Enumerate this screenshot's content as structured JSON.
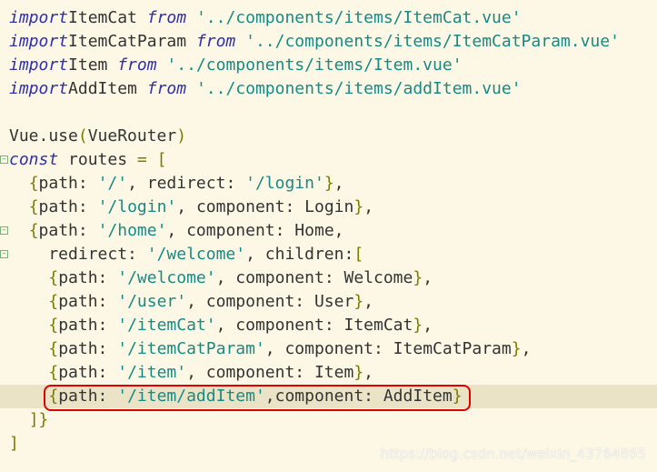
{
  "colors": {
    "background": "#fdf8e6",
    "keyword": "#2f2fb0",
    "string": "#178a84",
    "bracket": "#7b7b00",
    "highlight_line": "#ebe3c6",
    "annotation_box": "#e00000"
  },
  "lines": [
    [
      [
        "kw",
        "import"
      ],
      [
        "",
        "ItemCat "
      ],
      [
        "kw",
        "from"
      ],
      [
        "",
        " "
      ],
      [
        "str",
        "'../components/items/ItemCat.vue'"
      ]
    ],
    [
      [
        "kw",
        "import"
      ],
      [
        "",
        "ItemCatParam "
      ],
      [
        "kw",
        "from"
      ],
      [
        "",
        " "
      ],
      [
        "str",
        "'../components/items/ItemCatParam.vue'"
      ]
    ],
    [
      [
        "kw",
        "import"
      ],
      [
        "",
        "Item "
      ],
      [
        "kw",
        "from"
      ],
      [
        "",
        " "
      ],
      [
        "str",
        "'../components/items/Item.vue'"
      ]
    ],
    [
      [
        "kw",
        "import"
      ],
      [
        "",
        "AddItem "
      ],
      [
        "kw",
        "from"
      ],
      [
        "",
        " "
      ],
      [
        "str",
        "'../components/items/addItem.vue'"
      ]
    ],
    [],
    [
      [
        "",
        "Vue.use"
      ],
      [
        "br",
        "("
      ],
      [
        "",
        "VueRouter"
      ],
      [
        "br",
        ")"
      ]
    ],
    [
      [
        "kw",
        "const"
      ],
      [
        "",
        " routes "
      ],
      [
        "op",
        "="
      ],
      [
        "",
        " "
      ],
      [
        "br",
        "["
      ]
    ],
    [
      [
        "",
        "  "
      ],
      [
        "br",
        "{"
      ],
      [
        "",
        "path: "
      ],
      [
        "str",
        "'/'"
      ],
      [
        "",
        ", redirect: "
      ],
      [
        "str",
        "'/login'"
      ],
      [
        "br",
        "}"
      ],
      [
        "",
        ","
      ]
    ],
    [
      [
        "",
        "  "
      ],
      [
        "br",
        "{"
      ],
      [
        "",
        "path: "
      ],
      [
        "str",
        "'/login'"
      ],
      [
        "",
        ", component: Login"
      ],
      [
        "br",
        "}"
      ],
      [
        "",
        ","
      ]
    ],
    [
      [
        "",
        "  "
      ],
      [
        "br",
        "{"
      ],
      [
        "",
        "path: "
      ],
      [
        "str",
        "'/home'"
      ],
      [
        "",
        ", component: Home,"
      ]
    ],
    [
      [
        "",
        "    redirect: "
      ],
      [
        "str",
        "'/welcome'"
      ],
      [
        "",
        ", children:"
      ],
      [
        "br",
        "["
      ]
    ],
    [
      [
        "",
        "    "
      ],
      [
        "br",
        "{"
      ],
      [
        "",
        "path: "
      ],
      [
        "str",
        "'/welcome'"
      ],
      [
        "",
        ", component: Welcome"
      ],
      [
        "br",
        "}"
      ],
      [
        "",
        ","
      ]
    ],
    [
      [
        "",
        "    "
      ],
      [
        "br",
        "{"
      ],
      [
        "",
        "path: "
      ],
      [
        "str",
        "'/user'"
      ],
      [
        "",
        ", component: User"
      ],
      [
        "br",
        "}"
      ],
      [
        "",
        ","
      ]
    ],
    [
      [
        "",
        "    "
      ],
      [
        "br",
        "{"
      ],
      [
        "",
        "path: "
      ],
      [
        "str",
        "'/itemCat'"
      ],
      [
        "",
        ", component: ItemCat"
      ],
      [
        "br",
        "}"
      ],
      [
        "",
        ","
      ]
    ],
    [
      [
        "",
        "    "
      ],
      [
        "br",
        "{"
      ],
      [
        "",
        "path: "
      ],
      [
        "str",
        "'/itemCatParam'"
      ],
      [
        "",
        ", component: ItemCatParam"
      ],
      [
        "br",
        "}"
      ],
      [
        "",
        ","
      ]
    ],
    [
      [
        "",
        "    "
      ],
      [
        "br",
        "{"
      ],
      [
        "",
        "path: "
      ],
      [
        "str",
        "'/item'"
      ],
      [
        "",
        ", component: Item"
      ],
      [
        "br",
        "}"
      ],
      [
        "",
        ","
      ]
    ],
    [
      [
        "",
        "    "
      ],
      [
        "br",
        "{"
      ],
      [
        "",
        "path: "
      ],
      [
        "str",
        "'/item/addItem'"
      ],
      [
        "",
        ",component: AddItem"
      ],
      [
        "br",
        "}"
      ]
    ],
    [
      [
        "",
        "  "
      ],
      [
        "br",
        "]}"
      ]
    ],
    [
      [
        "br",
        "]"
      ]
    ]
  ],
  "highlighted_line": 16,
  "fold_markers": [
    6,
    9,
    10
  ],
  "watermark": "https://blog.csdn.net/weixin_43764865"
}
